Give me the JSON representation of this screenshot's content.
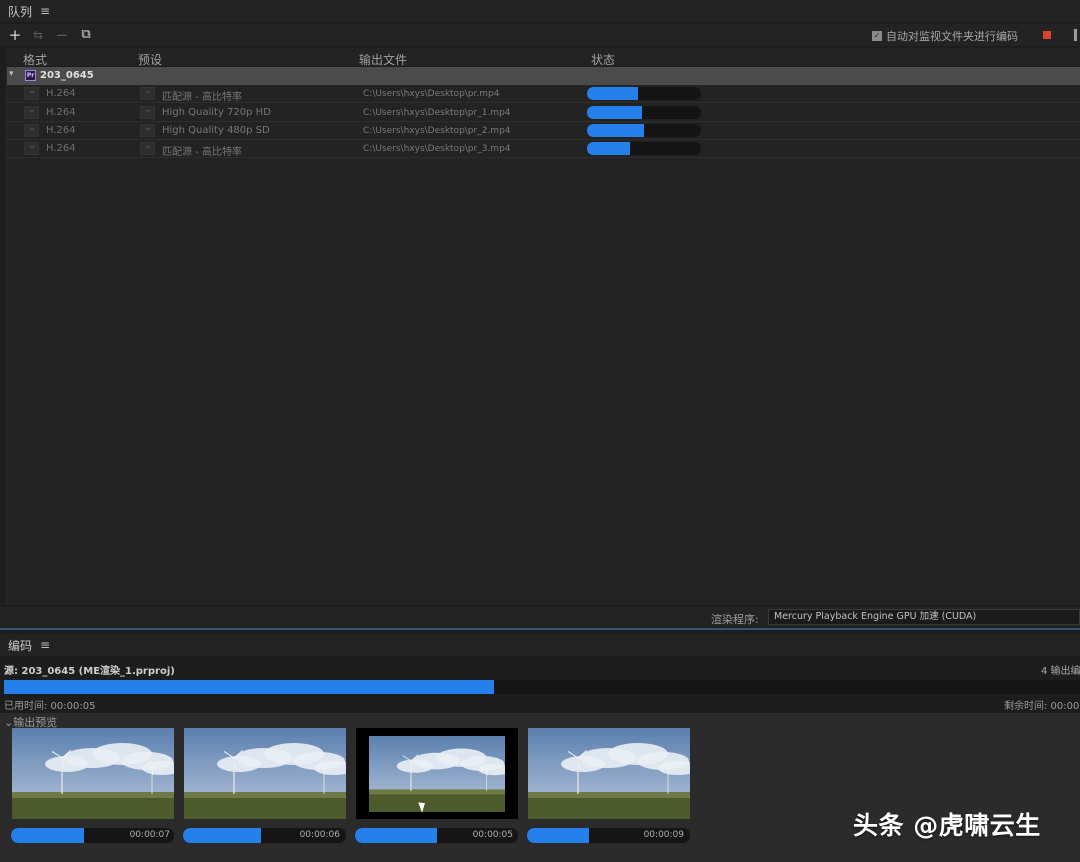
{
  "queue": {
    "title": "队列",
    "menu_icon": "≡",
    "toolbar": {
      "add": "+",
      "settings": "⇆",
      "remove": "−",
      "duplicate": "⧉"
    },
    "auto_encode_label": "自动对监视文件夹进行编码",
    "auto_encode_checked": true,
    "columns": {
      "format": "格式",
      "preset": "预设",
      "output": "输出文件",
      "status": "状态"
    },
    "group": {
      "name": "203_0645",
      "app_badge": "Pr"
    },
    "items": [
      {
        "format": "H.264",
        "preset": "匹配源 - 高比特率",
        "output": "C:\\Users\\hxys\\Desktop\\pr.mp4",
        "progress": 0.45
      },
      {
        "format": "H.264",
        "preset": "High Quality 720p HD",
        "output": "C:\\Users\\hxys\\Desktop\\pr_1.mp4",
        "progress": 0.48
      },
      {
        "format": "H.264",
        "preset": "High Quality 480p SD",
        "output": "C:\\Users\\hxys\\Desktop\\pr_2.mp4",
        "progress": 0.5
      },
      {
        "format": "H.264",
        "preset": "匹配源 - 高比特率",
        "output": "C:\\Users\\hxys\\Desktop\\pr_3.mp4",
        "progress": 0.38
      }
    ],
    "renderer_label": "渲染程序:",
    "renderer_value": "Mercury Playback Engine GPU 加速 (CUDA)"
  },
  "encoding": {
    "title": "编码",
    "menu_icon": "≡",
    "source": "源: 203_0645 (ME渲染_1.prproj)",
    "outputs": "4 输出编",
    "progress": 0.455,
    "elapsed": "已用时间: 00:00:05",
    "remaining": "剩余时间: 00:00",
    "preview_title": "输出预览",
    "previews": [
      {
        "time": "00:00:07",
        "progress": 0.45
      },
      {
        "time": "00:00:06",
        "progress": 0.48
      },
      {
        "time": "00:00:05",
        "progress": 0.5
      },
      {
        "time": "00:00:09",
        "progress": 0.38
      }
    ]
  },
  "watermark": "头条 @虎啸云生",
  "colors": {
    "accent": "#2680eb",
    "stop": "#d8432f",
    "background": "#1d1d1d"
  }
}
